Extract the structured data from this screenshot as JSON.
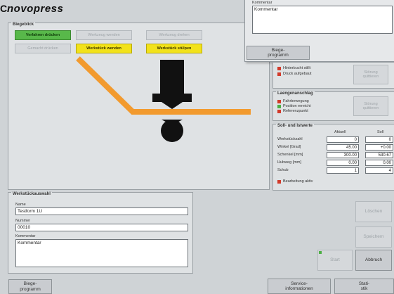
{
  "logo": "novopress",
  "edge_char": "C",
  "biegelinie": {
    "title": "Biegeblick",
    "buttons": {
      "verfahren_druecken": "Verfahren drücken",
      "gemacht": "Gemacht drücken",
      "disabled_1": "Werkzeug wenden",
      "disabled_2": "Werkzeug drehen",
      "werkstueck_wenden": "Werkstück wenden",
      "werkstueck_stuelpen": "Werkstück stülpen"
    }
  },
  "popup": {
    "field_label": "Kommentar",
    "field_value": "Kommentar",
    "button": "Biege-\nprogramm"
  },
  "status_top": {
    "leds": [
      "Hinterbucht stillt",
      "Druck aufgebaut"
    ],
    "button": "Störung\nquittieren"
  },
  "laengenanschlag": {
    "title": "Laengenanschlag",
    "leds": [
      "Fahrbewegung",
      "Position erreicht",
      "Referenzpunkt"
    ],
    "button": "Störung\nquittieren"
  },
  "soll_ist": {
    "title": "Soll- und Istwerte",
    "col_ist": "Aktuell",
    "col_soll": "Soll",
    "rows": [
      {
        "label": "Werkstückzahl",
        "ist": "0",
        "soll": "0"
      },
      {
        "label": "Winkel [Grad]",
        "ist": "45.00",
        "soll": "+0.00"
      },
      {
        "label": "Schenkel [mm]",
        "ist": "300.00",
        "soll": "530.67"
      },
      {
        "label": "Hubweg [mm]",
        "ist": "0.00",
        "soll": "0.00"
      },
      {
        "label": "Schub",
        "ist": "1",
        "soll": "4"
      }
    ],
    "led": "Bearbeitung aktiv"
  },
  "werkstueck": {
    "title": "Werkstückauswahl",
    "name_label": "Name",
    "name_value": "Testform 1U",
    "nummer_label": "Nummer",
    "nummer_value": "00010",
    "kommentar_label": "Kommentar",
    "kommentar_value": "Kommentar"
  },
  "right_buttons": {
    "loeschen": "Löschen",
    "speichern": "Speichern",
    "start": "Start",
    "abbruch": "Abbruch"
  },
  "bottom": {
    "biegeprogramm": "Biege-\nprogramm",
    "service": "Service-\ninformationen",
    "statistik": "Stati-\nstik"
  },
  "colors": {
    "background": "#cfd3d6",
    "panel": "#dfe2e4",
    "orange_workpiece": "#f29a2e",
    "green_button": "#58b84a",
    "yellow_button": "#f2e21b",
    "led_red": "#d23a2a",
    "led_green": "#4caf44"
  }
}
